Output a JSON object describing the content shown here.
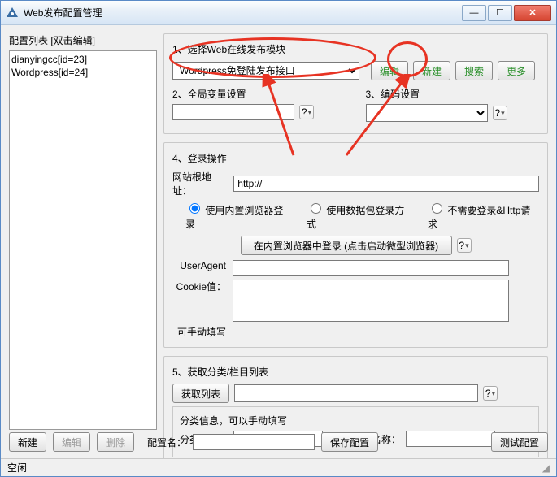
{
  "window": {
    "title": "Web发布配置管理"
  },
  "winbtns": {
    "min": "—",
    "max": "☐",
    "close": "✕"
  },
  "left": {
    "label": "配置列表  [双击编辑]",
    "items": [
      "dianyingcc[id=23]",
      "Wordpress[id=24]"
    ]
  },
  "section1": {
    "label": "1、选择Web在线发布模块",
    "select_value": "Wordpress免登陆发布接口",
    "btn_edit": "编辑",
    "btn_new": "新建",
    "btn_search": "搜索",
    "btn_more": "更多"
  },
  "section2": {
    "label": "2、全局变量设置",
    "value": ""
  },
  "section3": {
    "label": "3、编码设置",
    "value": ""
  },
  "section4": {
    "label": "4、登录操作",
    "root_label": "网站根地址：",
    "root_value": "http://",
    "radio1": "使用内置浏览器登录",
    "radio2": "使用数据包登录方式",
    "radio3": "不需要登录&Http请求",
    "login_btn": "在内置浏览器中登录 (点击启动微型浏览器)",
    "ua_label": "UserAgent",
    "ua_value": "",
    "cookie_label": "Cookie值：",
    "cookie_value": "",
    "manual_label": "可手动填写"
  },
  "section5": {
    "label": "5、获取分类/栏目列表",
    "btn_get": "获取列表",
    "list_value": "",
    "sub_label": "分类信息，可以手动填写",
    "id_label": "分类ID号：",
    "id_value": "",
    "name_label": "分类名称：",
    "name_value": ""
  },
  "bottom": {
    "btn_new": "新建",
    "btn_edit": "编辑",
    "btn_delete": "删除",
    "cfgname_label": "配置名：",
    "cfgname_value": "",
    "btn_save": "保存配置",
    "btn_test": "测试配置"
  },
  "status": {
    "text": "空闲"
  },
  "help": "?"
}
